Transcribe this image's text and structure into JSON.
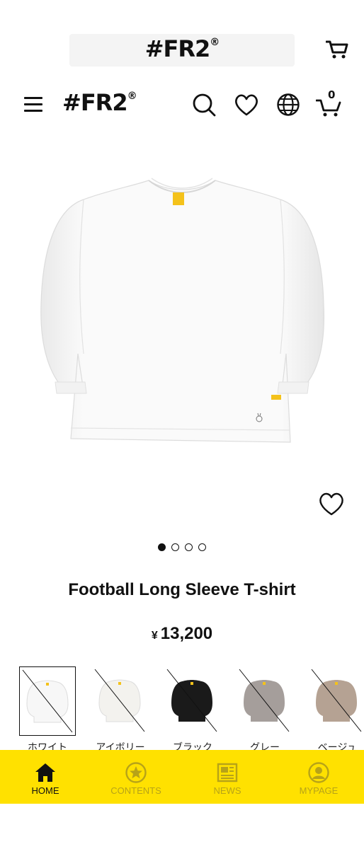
{
  "brand": {
    "name": "#FR2",
    "mark": "®"
  },
  "header": {
    "cart_count": "0"
  },
  "product": {
    "name": "Football Long Sleeve T-shirt",
    "currency": "¥",
    "price": "13,200",
    "image_count": 4,
    "active_image": 1
  },
  "colors": [
    {
      "label": "ホワイト",
      "hex": "#f7f7f7",
      "sold_out": true,
      "selected": true
    },
    {
      "label": "アイボリー",
      "hex": "#f3f2ee",
      "sold_out": true,
      "selected": false
    },
    {
      "label": "ブラック",
      "hex": "#1a1a1a",
      "sold_out": true,
      "selected": false
    },
    {
      "label": "グレー",
      "hex": "#a59e9b",
      "sold_out": true,
      "selected": false
    },
    {
      "label": "ベージュ",
      "hex": "#b5a293",
      "sold_out": true,
      "selected": false
    }
  ],
  "tabbar": {
    "tabs": [
      {
        "label": "HOME",
        "icon": "home-icon",
        "active": true
      },
      {
        "label": "CONTENTS",
        "icon": "star-circle-icon",
        "active": false
      },
      {
        "label": "NEWS",
        "icon": "newspaper-icon",
        "active": false
      },
      {
        "label": "MYPAGE",
        "icon": "user-circle-icon",
        "active": false
      }
    ]
  },
  "theme": {
    "accent": "#ffe100",
    "text": "#111111"
  }
}
